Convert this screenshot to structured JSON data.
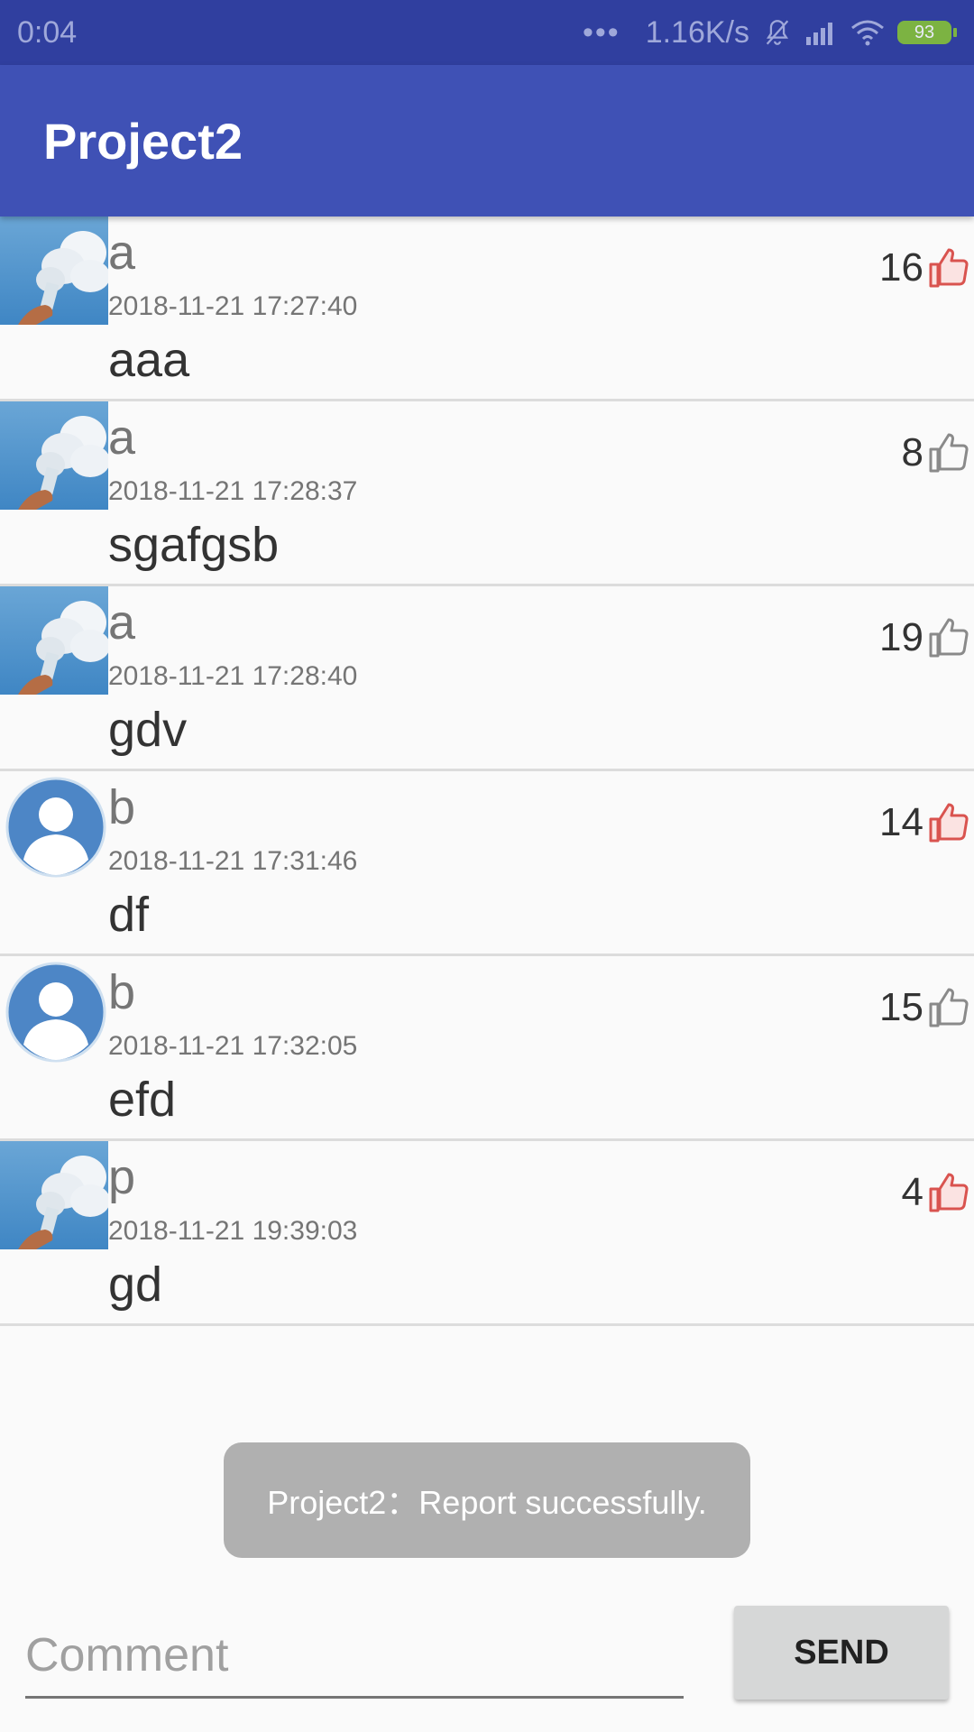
{
  "status_bar": {
    "time": "0:04",
    "dots": "•••",
    "speed": "1.16K/s",
    "battery": "93",
    "icons": [
      "mute-bell-icon",
      "signal-icon",
      "wifi-icon",
      "battery-icon"
    ]
  },
  "app_bar": {
    "title": "Project2"
  },
  "comments": [
    {
      "user": "a",
      "time": "2018-11-21 17:27:40",
      "text": "aaa",
      "likes": "16",
      "liked": true,
      "avatar": "cloud-photo"
    },
    {
      "user": "a",
      "time": "2018-11-21 17:28:37",
      "text": "sgafgsb",
      "likes": "8",
      "liked": false,
      "avatar": "cloud-photo"
    },
    {
      "user": "a",
      "time": "2018-11-21 17:28:40",
      "text": "gdv",
      "likes": "19",
      "liked": false,
      "avatar": "cloud-photo"
    },
    {
      "user": "b",
      "time": "2018-11-21 17:31:46",
      "text": "df",
      "likes": "14",
      "liked": true,
      "avatar": "default-person"
    },
    {
      "user": "b",
      "time": "2018-11-21 17:32:05",
      "text": "efd",
      "likes": "15",
      "liked": false,
      "avatar": "default-person"
    },
    {
      "user": "p",
      "time": "2018-11-21 19:39:03",
      "text": "gd",
      "likes": "4",
      "liked": true,
      "avatar": "cloud-photo"
    }
  ],
  "toast": {
    "message": "Project2：Report successfully."
  },
  "composer": {
    "placeholder": "Comment",
    "value": "",
    "send_label": "SEND"
  },
  "colors": {
    "status_bar": "#303f9f",
    "app_bar": "#3f51b5",
    "liked": "#d9534f",
    "unliked": "#8a8a8a"
  }
}
